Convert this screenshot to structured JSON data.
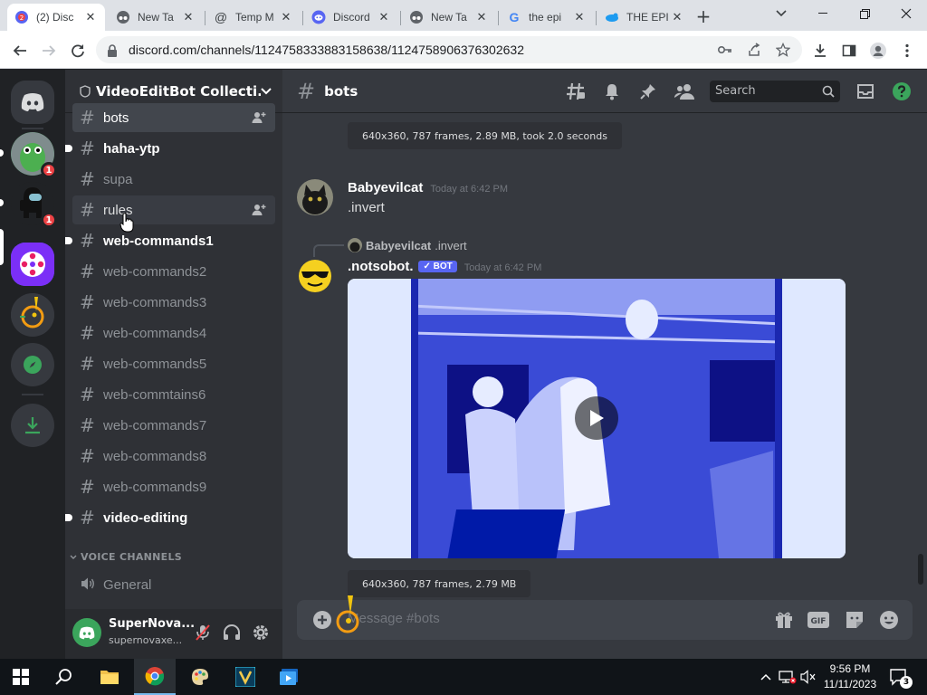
{
  "browser": {
    "tabs": [
      {
        "title": "(2) Disc",
        "icon": "discord-badge-icon"
      },
      {
        "title": "New Ta",
        "icon": "incognito-icon"
      },
      {
        "title": "Temp M",
        "icon": "at-sign-icon"
      },
      {
        "title": "Discord",
        "icon": "discord-icon"
      },
      {
        "title": "New Ta",
        "icon": "incognito-icon"
      },
      {
        "title": "the epi",
        "icon": "google-icon"
      },
      {
        "title": "THE EPI",
        "icon": "bird-icon"
      }
    ],
    "url": "discord.com/channels/1124758333883158638/1124758906376302632"
  },
  "server": {
    "name": "VideoEditBot Collecti...",
    "channels": [
      {
        "name": "bots",
        "state": "selected",
        "invite": true,
        "dot": false
      },
      {
        "name": "haha-ytp",
        "state": "unread",
        "invite": false,
        "dot": true
      },
      {
        "name": "supa",
        "state": "normal",
        "invite": false,
        "dot": false
      },
      {
        "name": "rules",
        "state": "hover",
        "invite": true,
        "dot": false
      },
      {
        "name": "web-commands1",
        "state": "unread",
        "invite": false,
        "dot": true
      },
      {
        "name": "web-commands2",
        "state": "normal",
        "invite": false,
        "dot": false
      },
      {
        "name": "web-commands3",
        "state": "normal",
        "invite": false,
        "dot": false
      },
      {
        "name": "web-commands4",
        "state": "normal",
        "invite": false,
        "dot": false
      },
      {
        "name": "web-commands5",
        "state": "normal",
        "invite": false,
        "dot": false
      },
      {
        "name": "web-commtains6",
        "state": "normal",
        "invite": false,
        "dot": false
      },
      {
        "name": "web-commands7",
        "state": "normal",
        "invite": false,
        "dot": false
      },
      {
        "name": "web-commands8",
        "state": "normal",
        "invite": false,
        "dot": false
      },
      {
        "name": "web-commands9",
        "state": "normal",
        "invite": false,
        "dot": false
      },
      {
        "name": "video-editing",
        "state": "unread",
        "invite": false,
        "dot": true
      }
    ],
    "voice_category": "VOICE CHANNELS",
    "voice_channels": [
      {
        "name": "General"
      }
    ]
  },
  "guild_badges": [
    "1",
    "1"
  ],
  "user": {
    "name": "SuperNova...",
    "tag": "supernovaxe..."
  },
  "chat": {
    "channel": "bots",
    "search_placeholder": "Search",
    "top_meta": "640x360, 787 frames, 2.89 MB, took 2.0 seconds",
    "message1": {
      "author": "Babyevilcat",
      "time": "Today at 6:42 PM",
      "text": ".invert"
    },
    "reply": {
      "author": "Babyevilcat",
      "text": ".invert"
    },
    "message2": {
      "author": ".notsobot.",
      "badge": "✓ BOT",
      "time": "Today at 6:42 PM"
    },
    "bottom_meta": "640x360, 787 frames, 2.79 MB",
    "composer_placeholder": "Message #bots"
  },
  "taskbar": {
    "time": "9:56 PM",
    "date": "11/11/2023",
    "notifications": "3"
  },
  "colors": {
    "blurple": "#5865f2",
    "green": "#3ba55c",
    "red": "#ed4245"
  }
}
